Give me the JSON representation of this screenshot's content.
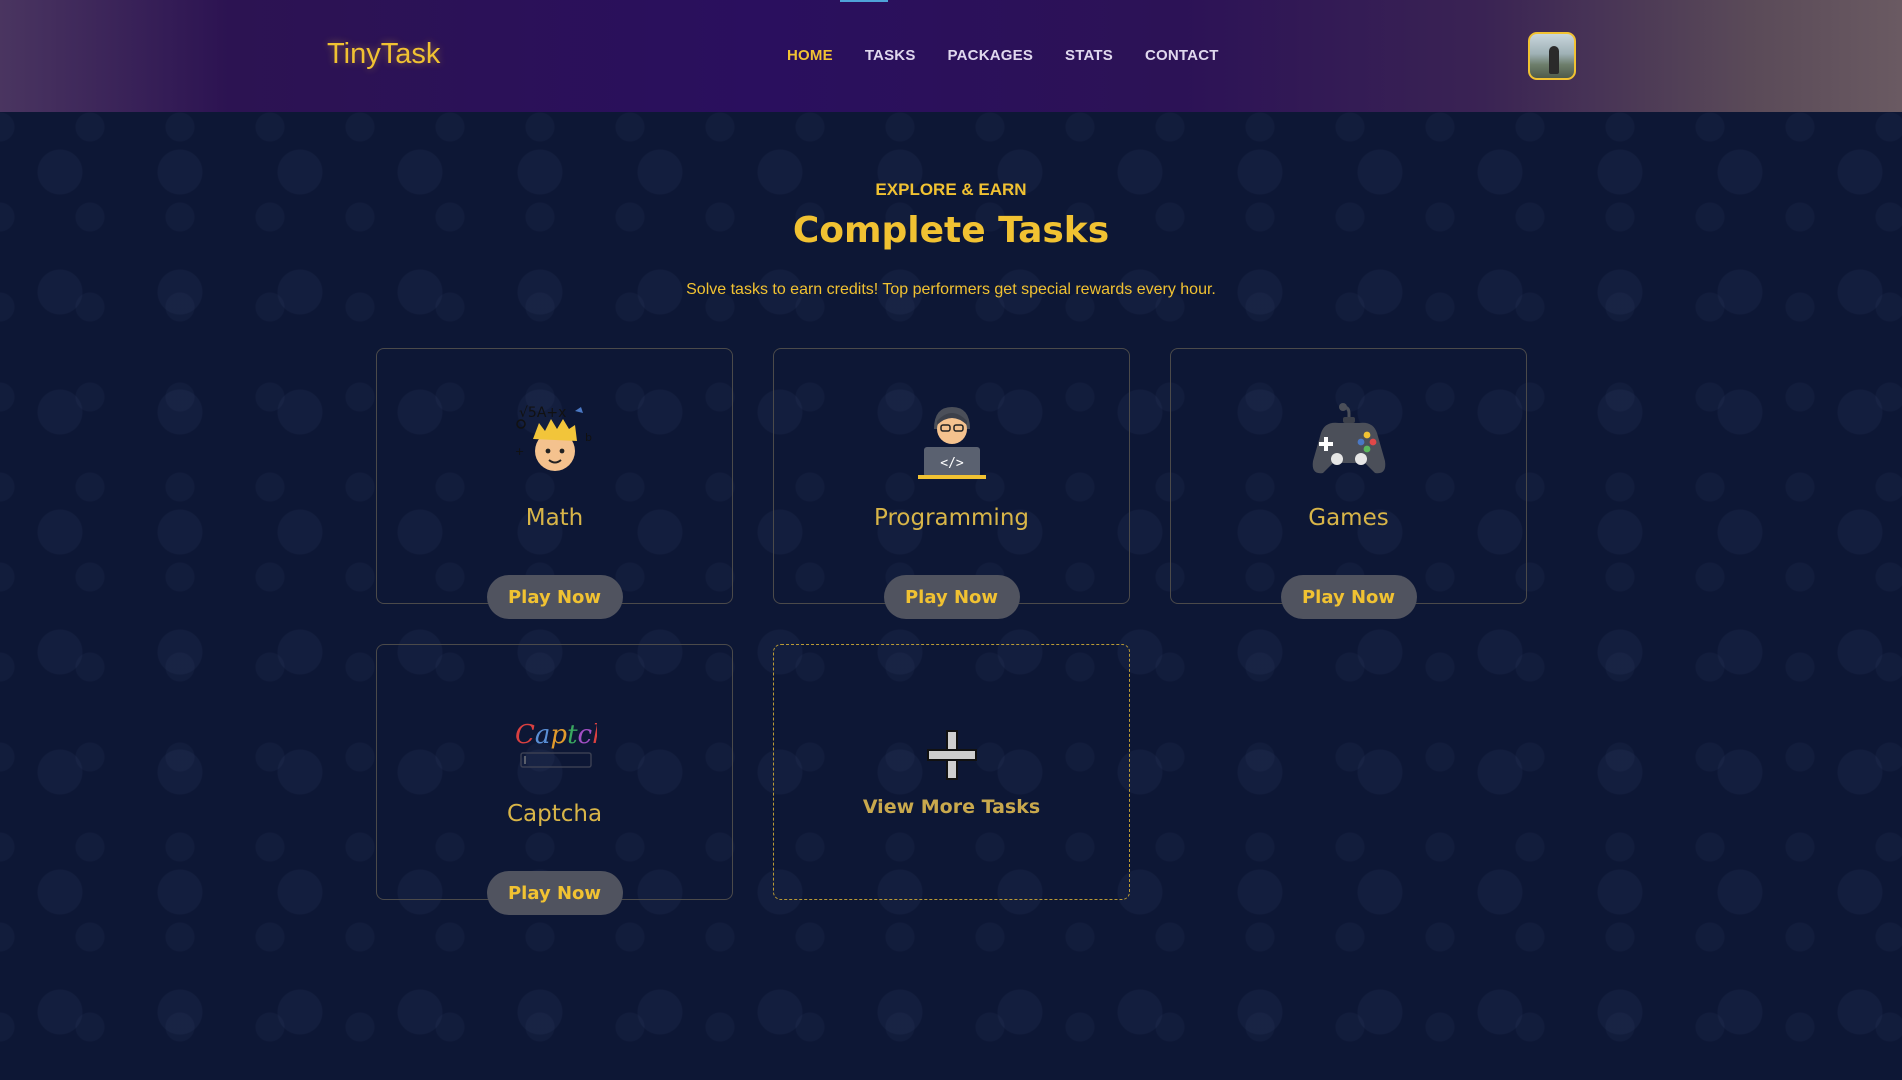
{
  "header": {
    "logo": "TinyTask",
    "nav": [
      {
        "label": "HOME"
      },
      {
        "label": "TASKS"
      },
      {
        "label": "PACKAGES"
      },
      {
        "label": "STATS"
      },
      {
        "label": "CONTACT"
      }
    ],
    "active_nav": "HOME"
  },
  "hero": {
    "eyebrow": "EXPLORE & EARN",
    "title": "Complete Tasks",
    "subtitle": "Solve tasks to earn credits! Top performers get special rewards every hour."
  },
  "tasks": [
    {
      "name": "Math",
      "icon": "math-icon",
      "button": "Play Now"
    },
    {
      "name": "Programming",
      "icon": "programmer-icon",
      "button": "Play Now"
    },
    {
      "name": "Games",
      "icon": "gamepad-icon",
      "button": "Play Now"
    },
    {
      "name": "Captcha",
      "icon": "captcha-icon",
      "button": "Play Now"
    }
  ],
  "more": {
    "label": "View More Tasks",
    "icon": "plus-icon"
  },
  "colors": {
    "accent": "#f1c232",
    "background": "#0d1735",
    "button_bg": "#50535f",
    "header_purple": "#2a0f5e"
  }
}
